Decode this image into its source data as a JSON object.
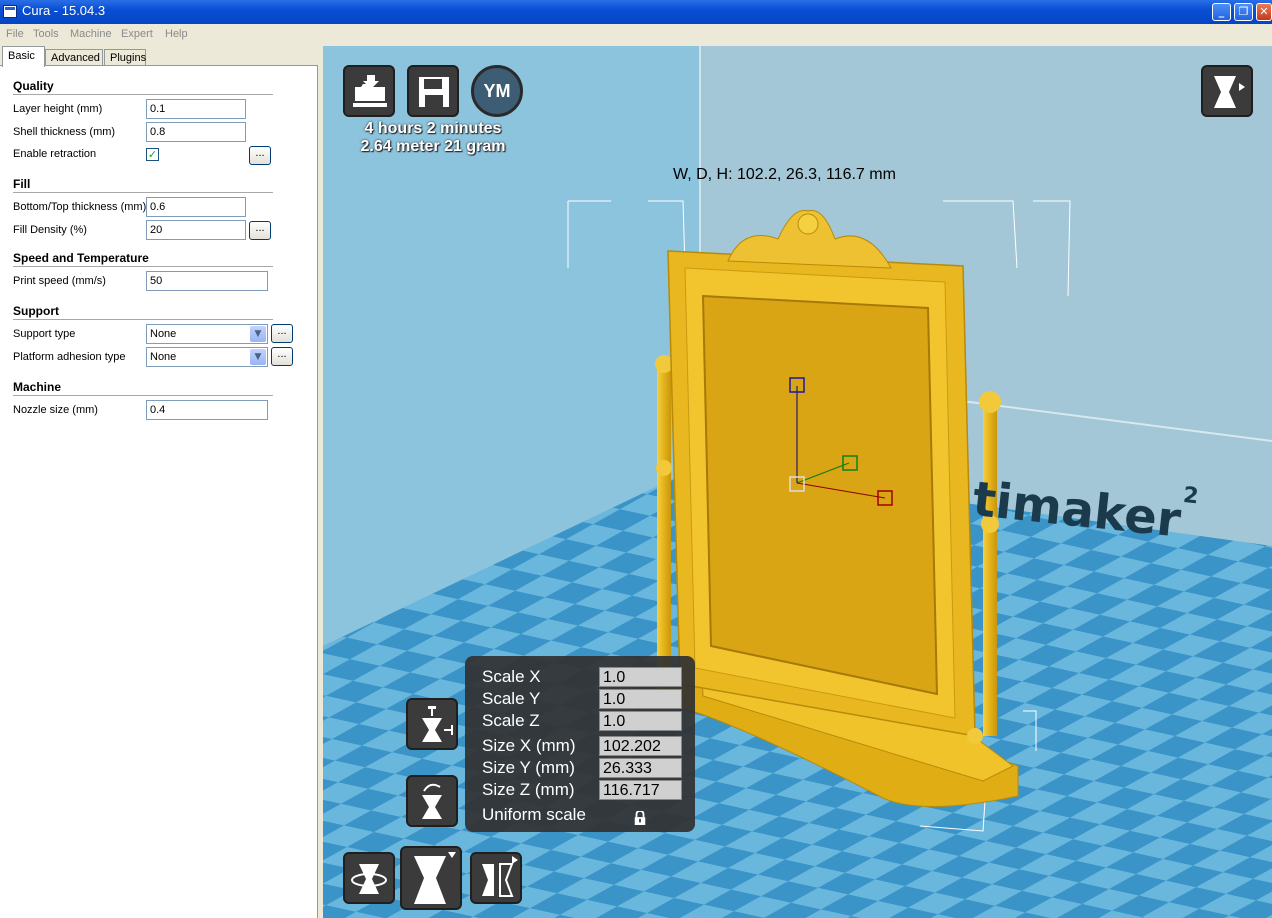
{
  "window": {
    "title": "Cura - 15.04.3",
    "buttons": {
      "minimize": "_",
      "restore": "❐",
      "close": "✕"
    }
  },
  "menu": [
    "File",
    "Tools",
    "Machine",
    "Expert",
    "Help"
  ],
  "tabs": [
    "Basic",
    "Advanced",
    "Plugins"
  ],
  "sections": {
    "quality": "Quality",
    "fill": "Fill",
    "speed": "Speed and Temperature",
    "support": "Support",
    "machine": "Machine"
  },
  "fields": {
    "layer_height": {
      "label": "Layer height (mm)",
      "value": "0.1"
    },
    "shell_thickness": {
      "label": "Shell thickness (mm)",
      "value": "0.8"
    },
    "enable_retraction": {
      "label": "Enable retraction",
      "checked": "✓"
    },
    "bottom_top": {
      "label": "Bottom/Top thickness (mm)",
      "value": "0.6"
    },
    "fill_density": {
      "label": "Fill Density (%)",
      "value": "20"
    },
    "print_speed": {
      "label": "Print speed (mm/s)",
      "value": "50"
    },
    "support_type": {
      "label": "Support type",
      "value": "None"
    },
    "platform_adhesion": {
      "label": "Platform adhesion type",
      "value": "None"
    },
    "nozzle_size": {
      "label": "Nozzle size (mm)",
      "value": "0.4"
    }
  },
  "more_button": "...",
  "viewport": {
    "ym_label": "YM",
    "print_time": "4 hours 2 minutes",
    "print_material": "2.64 meter 21 gram",
    "dimensions": "W, D, H: 102.2, 26.3, 116.7 mm",
    "brand_text": "timaker",
    "brand_sup": "2"
  },
  "scale": {
    "scale_x": {
      "label": "Scale X",
      "value": "1.0"
    },
    "scale_y": {
      "label": "Scale Y",
      "value": "1.0"
    },
    "scale_z": {
      "label": "Scale Z",
      "value": "1.0"
    },
    "size_x": {
      "label": "Size X (mm)",
      "value": "102.202"
    },
    "size_y": {
      "label": "Size Y (mm)",
      "value": "26.333"
    },
    "size_z": {
      "label": "Size Z (mm)",
      "value": "116.717"
    },
    "uniform": "Uniform scale"
  },
  "colors": {
    "model": "#e8b81c",
    "sky": "#7db6d4",
    "floor_a": "#3a94c8",
    "floor_b": "#6ab7de"
  }
}
